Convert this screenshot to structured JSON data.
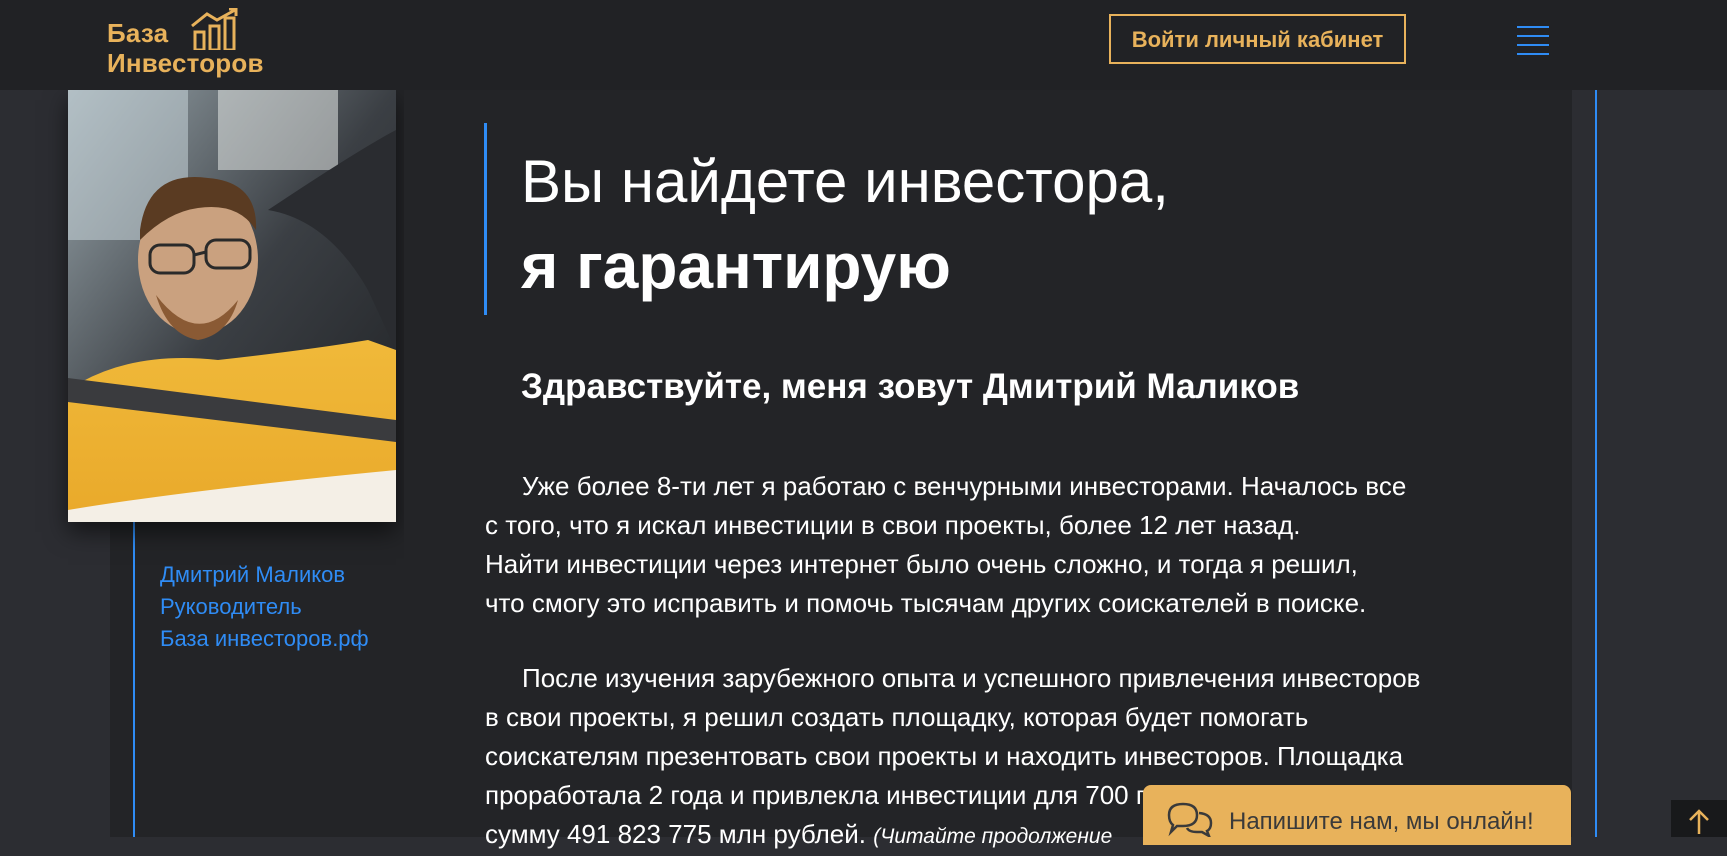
{
  "header": {
    "logo_line1": "База",
    "logo_line2": "Инвесторов",
    "login_label": "Войти личный кабинет",
    "menu_icon": "hamburger-menu-icon"
  },
  "profile": {
    "photo_alt": "Дмитрий Маликов",
    "name": "Дмитрий Маликов",
    "role": "Руководитель",
    "site": "База инвесторов.рф"
  },
  "main": {
    "headline_line1": "Вы найдете инвестора,",
    "headline_line2": "я гарантирую",
    "greeting": "Здравствуйте, меня зовут Дмитрий Маликов",
    "paragraph1": [
      "Уже более 8-ти лет я работаю с венчурными инвесторами. Началось все",
      "с того, что я искал инвестиции в свои проекты, более 12 лет назад.",
      "Найти инвестиции через интернет было очень сложно, и тогда я решил,",
      "что смогу это исправить и помочь тысячам других соискателей в поиске."
    ],
    "paragraph2": [
      "После изучения зарубежного опыта и успешного привлечения инвесторов",
      "в свои проекты, я решил создать площадку, которая будет помогать",
      "соискателям презентовать свои проекты и находить инвесторов. Площадка",
      "проработала 2 года и привлекла инвестиции для 700 проектов на общую",
      "сумму 491 823 775 млн рублей."
    ],
    "read_more": "(Читайте продолжение"
  },
  "chat": {
    "label": "Напишите нам, мы онлайн!",
    "icon": "chat-bubbles-icon"
  },
  "scroll_top": {
    "icon": "arrow-up-icon"
  },
  "colors": {
    "accent_gold": "#e8b25b",
    "accent_blue": "#2f8cf5",
    "background": "#2c2d32",
    "panel": "#232427",
    "header": "#212225"
  }
}
